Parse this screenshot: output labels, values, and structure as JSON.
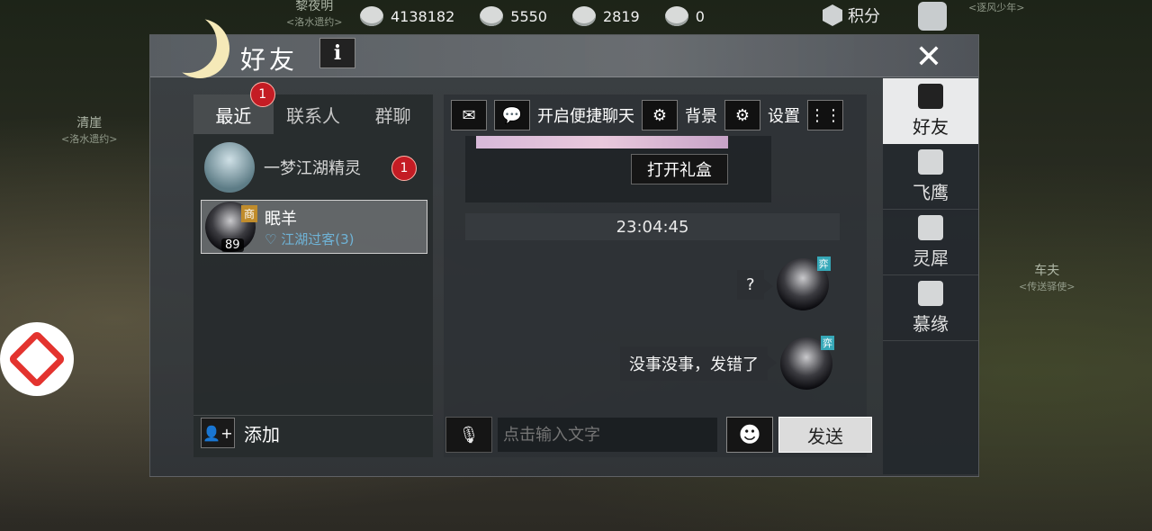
{
  "world": {
    "labels": [
      {
        "name": "黎夜明",
        "sub": "<洛水遗约>"
      },
      {
        "name": "清崖",
        "sub": "<洛水遗约>"
      },
      {
        "name": "车夫",
        "sub": "<传送驿使>"
      },
      {
        "name": "",
        "sub": "<逐风少年>"
      }
    ]
  },
  "topbar": {
    "resources": [
      {
        "icon": "coin-icon",
        "value": "4138182"
      },
      {
        "icon": "silver-icon",
        "value": "5550"
      },
      {
        "icon": "ticket-icon",
        "value": "2819"
      },
      {
        "icon": "gold-icon",
        "value": "0"
      }
    ],
    "points_label": "积分"
  },
  "dialog": {
    "title": "好友",
    "info_label": "i",
    "close_label": "✕"
  },
  "left_panel": {
    "tabs": [
      {
        "label": "最近",
        "badge": "1",
        "active": true
      },
      {
        "label": "联系人",
        "badge": "",
        "active": false
      },
      {
        "label": "群聊",
        "badge": "",
        "active": false
      }
    ],
    "friends": [
      {
        "name": "一梦江湖精灵",
        "badge": "1"
      },
      {
        "name": "眠羊",
        "level": "89",
        "shop_tag": "商",
        "relation": "江湖过客(3)"
      }
    ],
    "add_label": "添加"
  },
  "chat": {
    "toolbar": {
      "quick_chat_label": "开启便捷聊天",
      "background_label": "背景",
      "settings_label": "设置"
    },
    "gift_button": "打开礼盒",
    "timestamp": "23:04:45",
    "messages": [
      {
        "text": "?",
        "tag": "弈"
      },
      {
        "text": "没事没事，发错了",
        "tag": "弈"
      }
    ],
    "input": {
      "placeholder": "点击输入文字"
    },
    "send_label": "发送"
  },
  "right_nav": {
    "items": [
      {
        "label": "好友",
        "icon": "teapot-icon",
        "active": true
      },
      {
        "label": "飞鹰",
        "icon": "scroll-icon",
        "active": false
      },
      {
        "label": "灵犀",
        "icon": "pendant-icon",
        "active": false
      },
      {
        "label": "慕缘",
        "icon": "crane-icon",
        "active": false
      }
    ]
  },
  "colors": {
    "badge_red": "#c41c24",
    "relation_blue": "#6fb3d6",
    "moon": "#f5e9b8",
    "logo_red": "#e3332e"
  }
}
